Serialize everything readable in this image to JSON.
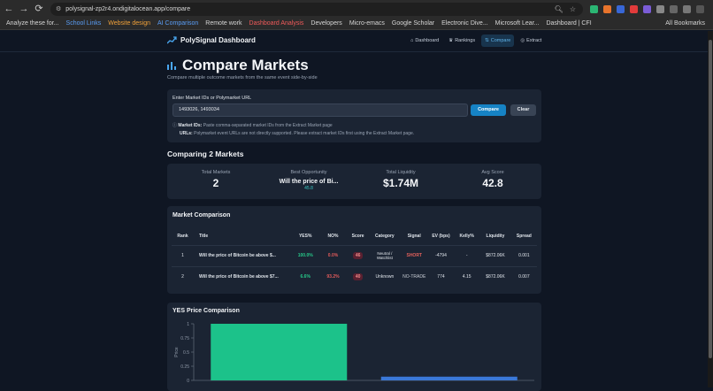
{
  "browser": {
    "url": "polysignal-zp2r4.ondigitalocean.app/compare",
    "bookmarks": [
      {
        "label": "Analyze these for...",
        "color": "#d6d6d6"
      },
      {
        "label": "School Links",
        "color": "#5a9df5"
      },
      {
        "label": "Website design",
        "color": "#f0a13a"
      },
      {
        "label": "AI Comparison",
        "color": "#5a9df5"
      },
      {
        "label": "Remote work",
        "color": "#d6d6d6"
      },
      {
        "label": "Dashboard Analysis",
        "color": "#f05a5a"
      },
      {
        "label": "Developers",
        "color": "#d6d6d6"
      },
      {
        "label": "Micro-emacs",
        "color": "#d6d6d6"
      },
      {
        "label": "Google Scholar",
        "color": "#d6d6d6"
      },
      {
        "label": "Electronic Dive...",
        "color": "#d6d6d6"
      },
      {
        "label": "Microsoft Lear...",
        "color": "#d6d6d6"
      },
      {
        "label": "Dashboard | CFI",
        "color": "#d6d6d6"
      }
    ],
    "all_bookmarks": "All Bookmarks"
  },
  "header": {
    "brand": "PolySignal Dashboard",
    "nav": [
      {
        "label": "Dashboard",
        "icon": "home-icon"
      },
      {
        "label": "Rankings",
        "icon": "trophy-icon"
      },
      {
        "label": "Compare",
        "icon": "compare-icon",
        "active": true
      },
      {
        "label": "Extract",
        "icon": "target-icon"
      }
    ]
  },
  "page": {
    "title": "Compare Markets",
    "subtitle": "Compare multiple outcome markets from the same event side-by-side"
  },
  "input": {
    "label": "Enter Market IDs or Polymarket URL",
    "value": "1493026, 1493034",
    "compare_label": "Compare",
    "clear_label": "Clear",
    "hint1_bold": "Market IDs:",
    "hint1_text": " Paste comma-separated market IDs from the Extract Market page",
    "hint2_bold": "URLs:",
    "hint2_text": " Polymarket event URLs are not directly supported. Please extract market IDs first using the Extract Market page."
  },
  "summary": {
    "heading": "Comparing 2 Markets",
    "total_markets_label": "Total Markets",
    "total_markets": "2",
    "best_label": "Best Opportunity",
    "best_value": "Will the price of Bi...",
    "best_sub": "45.8",
    "liquidity_label": "Total Liquidity",
    "liquidity": "$1.74M",
    "avg_label": "Avg Score",
    "avg": "42.8"
  },
  "table": {
    "title": "Market Comparison",
    "headers": {
      "rank": "Rank",
      "title": "Title",
      "yes": "YES%",
      "no": "NO%",
      "score": "Score",
      "category": "Category",
      "signal": "Signal",
      "ev": "EV (bps)",
      "kelly": "Kelly%",
      "liquidity": "Liquidity",
      "spread": "Spread"
    },
    "rows": [
      {
        "rank": "1",
        "title": "Will the price of Bitcoin be above $...",
        "yes": "100.0%",
        "no": "0.0%",
        "score": "46",
        "category": "Neutral / Watchlist",
        "signal": "SHORT",
        "ev": "-4794",
        "kelly": "-",
        "liquidity": "$872.06K",
        "spread": "0.001"
      },
      {
        "rank": "2",
        "title": "Will the price of Bitcoin be above $7...",
        "yes": "6.6%",
        "no": "93.2%",
        "score": "40",
        "category": "Unknown",
        "signal": "NO-TRADE",
        "ev": "774",
        "kelly": "4.15",
        "liquidity": "$872.06K",
        "spread": "0.007"
      }
    ]
  },
  "chart_data": {
    "type": "bar",
    "title": "YES Price Comparison",
    "ylabel": "Price",
    "ylim": [
      0,
      1
    ],
    "yticks": [
      "0",
      "0.25",
      "0.5",
      "0.75",
      "1"
    ],
    "categories": [
      "",
      ""
    ],
    "values": [
      1.0,
      0.066
    ],
    "colors": [
      "#1cc28a",
      "#3a78d8"
    ]
  }
}
